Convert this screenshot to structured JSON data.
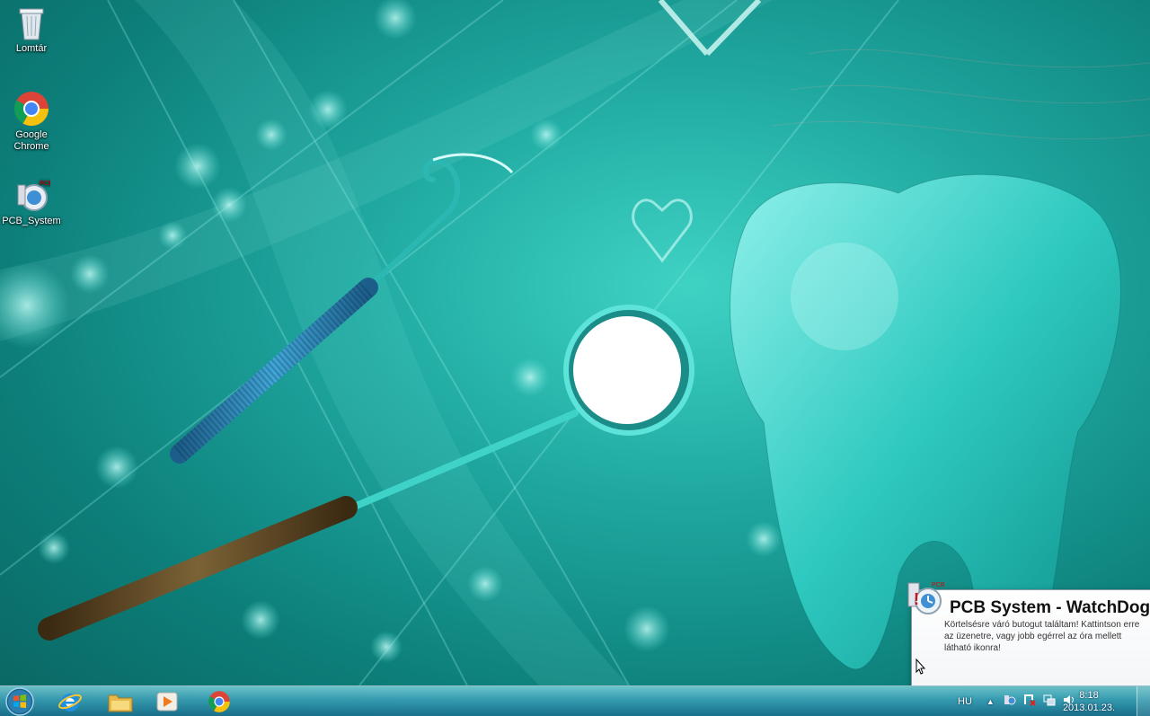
{
  "desktop": {
    "icons": [
      {
        "label": "Lomtár",
        "icon": "recycle-bin-icon"
      },
      {
        "label": "Google Chrome",
        "icon": "chrome-icon"
      },
      {
        "label": "PCB_System",
        "icon": "pcb-system-icon"
      }
    ]
  },
  "notification": {
    "title": "PCB System - WatchDog",
    "message": "Körtelsésre váró butogut találtam! Kattintson erre az üzenetre, vagy jobb egérrel az óra mellett látható ikonra!",
    "icon": "pcb-watchdog-icon"
  },
  "taskbar": {
    "pinned": [
      {
        "name": "internet-explorer-icon"
      },
      {
        "name": "file-explorer-icon"
      },
      {
        "name": "media-player-icon"
      },
      {
        "name": "chrome-icon"
      }
    ],
    "language": "HU",
    "time": "8:18",
    "date": "2013.01.23."
  },
  "colors": {
    "wallpaper_teal": "#1fa8a0",
    "taskbar": "#3c9fb9"
  }
}
